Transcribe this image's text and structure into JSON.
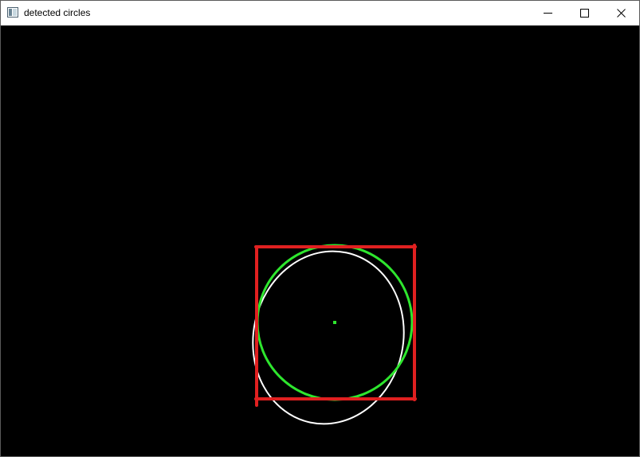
{
  "window": {
    "title": "detected circles",
    "icon": "window-app-icon"
  },
  "controls": {
    "minimize_icon": "minimize-icon",
    "maximize_icon": "maximize-icon",
    "close_icon": "close-icon"
  },
  "overlay_colors": {
    "background": "#000000",
    "white_ellipse": "#ffffff",
    "green_circle": "#2ee62e",
    "green_center": "#2ee62e",
    "red_box": "#e02020"
  }
}
